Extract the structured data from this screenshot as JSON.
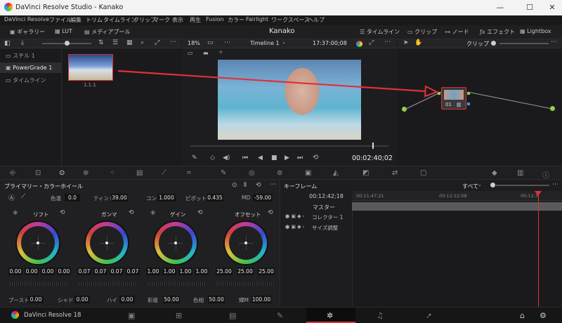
{
  "window": {
    "title": "DaVinci Resolve Studio - Kanako",
    "minimize": "—",
    "maximize": "☐",
    "close": "✕"
  },
  "menu": [
    "DaVinci Resolve",
    "ファイル",
    "編集",
    "トリム",
    "タイムライン",
    "クリップ",
    "マーク",
    "表示",
    "再生",
    "Fusion",
    "カラー",
    "Fairlight",
    "ワークスペース",
    "ヘルプ"
  ],
  "toolbar": {
    "gallery": "ギャラリー",
    "lut": "LUT",
    "mediapool": "メディアプール",
    "project": "Kanako",
    "timeline": "タイムライン",
    "clip": "クリップ",
    "node": "ノード",
    "effects": "エフェクト",
    "lightbox": "Lightbox"
  },
  "viewer_bar": {
    "zoom": "18%",
    "timeline_name": "Timeline 1",
    "timecode": "17:37:00;08",
    "node_mode": "クリップ"
  },
  "gallery": {
    "sidebar": [
      "スチル 1",
      "PowerGrade 1",
      "タイムライン"
    ],
    "still_label": "1.1.1"
  },
  "viewer": {
    "timecode": "00:02:40;02"
  },
  "node": {
    "label": "01"
  },
  "color_panel": {
    "title": "プライマリー・カラーホイール",
    "temp_label": "色温",
    "temp_value": "0.0",
    "tint_label": "ティント",
    "tint_value": "39.00",
    "contrast_label": "コン",
    "contrast_value": "1.000",
    "pivot_label": "ピボット",
    "pivot_value": "0.435",
    "md_label": "MD",
    "md_value": "-59.00",
    "wheels": [
      {
        "name": "リフト",
        "values": [
          "0.00",
          "0.00",
          "0.00",
          "0.00"
        ]
      },
      {
        "name": "ガンマ",
        "values": [
          "0.07",
          "0.07",
          "0.07",
          "0.07"
        ]
      },
      {
        "name": "ゲイン",
        "values": [
          "1.00",
          "1.00",
          "1.00",
          "1.00"
        ]
      },
      {
        "name": "オフセット",
        "values": [
          "25.00",
          "25.00",
          "25.00"
        ]
      }
    ],
    "bottom": [
      {
        "label": "ブースト",
        "value": "0.00"
      },
      {
        "label": "シャド",
        "value": "0.00"
      },
      {
        "label": "ハイ",
        "value": "0.00"
      },
      {
        "label": "彩度",
        "value": "50.00"
      },
      {
        "label": "色相",
        "value": "50.00"
      },
      {
        "label": "輝M",
        "value": "100.00"
      }
    ]
  },
  "keyframe": {
    "title": "キーフレーム",
    "filter": "すべて",
    "timecode": "00:12:42;18",
    "ruler": [
      "00:11:47;21",
      "00:12:12;08",
      "00:12:3"
    ],
    "master": "マスター",
    "tracks": [
      "コレクター 1",
      "サイズ調整"
    ]
  },
  "app": {
    "version": "DaVinci Resolve 18"
  },
  "colors": {
    "accent": "#e0303a",
    "playhead": "#e0303a",
    "node_border": "#d83030"
  }
}
